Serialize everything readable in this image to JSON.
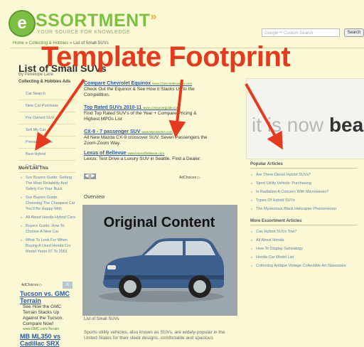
{
  "header": {
    "logo_letter": "e",
    "logo_word": "SSORTMENT",
    "logo_mark": "»",
    "tagline": "YOUR SOURCE FOR KNOWLEDGE",
    "search_placeholder": "Google™ Custom Search",
    "search_button": "Search"
  },
  "breadcrumb": {
    "home": "Home",
    "sep1": " » ",
    "section": "Collecting & Hobbies",
    "sep2": " » ",
    "current": "List of Small SUVs"
  },
  "overlay": {
    "title": "Template Footprint",
    "content_label": "Original Content"
  },
  "article": {
    "title": "List of Small SUVs",
    "byline": "By Penelope Lane",
    "section_head": "Collecting & Hobbies Ads",
    "overview": "Overview",
    "caption": "List of Small SUVs",
    "body": "Sports utility vehicles, also known as SUVs, are widely-popular in the United States for their sleek designs, comfortable and spacious"
  },
  "left_nav": {
    "items": [
      "Car Search",
      "New Car Purchase",
      "Pre Owned SUV",
      "Sell My Car",
      "Preowned Cars",
      "Best Hybrid",
      "Car Tires"
    ]
  },
  "more_like_this": {
    "heading": "More Like This",
    "items": [
      "Suv Buyers Guide: Getting The Most Reliability And Safety For Your Buck",
      "Suv Buyers Guide: Choosing The Cheapest Car You'll Be Happy With",
      "All About Honda Hybrid Cars",
      "Buyers Guide: How To Choose A New Car",
      "What To Look For When Buying A Used Honda Crv Model Years 97 To 2001"
    ]
  },
  "left_ads": {
    "adchoices": "AdChoices ▷",
    "button": "X",
    "tucson_title": "Tucson vs. GMC Terrain",
    "tucson_desc": "See How the GMC Terrain Stacks Up Against the Tucson. Compare Now!",
    "tucson_url": "www.GMC.com/Terrain",
    "ml_title": "MB ML350 vs Cadillac SRX"
  },
  "center_ads": [
    {
      "title": "Compare Chevrolet Equinox",
      "url": "www.ChevroletEquinox.com",
      "desc": "Check Out the Equinox & See How it Stacks Up to the Competition."
    },
    {
      "title": "Top Rated SUVs 2010-11",
      "url": "www.consumerguide.com",
      "desc": "Find Top Rated SUV's of the Year + Compare Pricing & Highest MPGs List"
    },
    {
      "title": "CX-9 - 7 passenger SUV",
      "url": "www.MazdaUSA.com",
      "desc": "All New Mazda CX-9 crossover SUV. Seven Passengers the Zoom-Zoom Way."
    },
    {
      "title": "Lexus of Bellevue",
      "url": "www.lexusofbellevue.com",
      "desc": "Lexus: Test Drive a Luxury SUV in Seattle. Find a Dealer."
    }
  ],
  "center_adchoices": "AdChoices ▷",
  "center_arrows": [
    "◀",
    "▶"
  ],
  "right_ad": {
    "text_light": "it is now ",
    "text_dark": "bea"
  },
  "popular_articles": {
    "heading": "Popular Articles",
    "items": [
      "Are There Diesel Hybrid SUVs?",
      "Sport Utility Vehicle: Purchasing",
      "Is Radiation A Concern With Microwaves?",
      "Types Of Hybrid SUVs",
      "The Mysterious Black Helicopter Phenomenon"
    ]
  },
  "more_essortment": {
    "heading": "More Essortment Articles",
    "items": [
      "Can Hybrid SUVs Tow?",
      "All About Honda",
      "How To Display Genealogy",
      "Honda Car Model List",
      "Collecting Antique Vintage Collectible Art Glassware"
    ]
  },
  "colors": {
    "overlay_red": "#e63a1f",
    "brand_green": "#7cc043",
    "link_blue": "#2b5aa6",
    "page_bg": "#fbf8d6"
  }
}
